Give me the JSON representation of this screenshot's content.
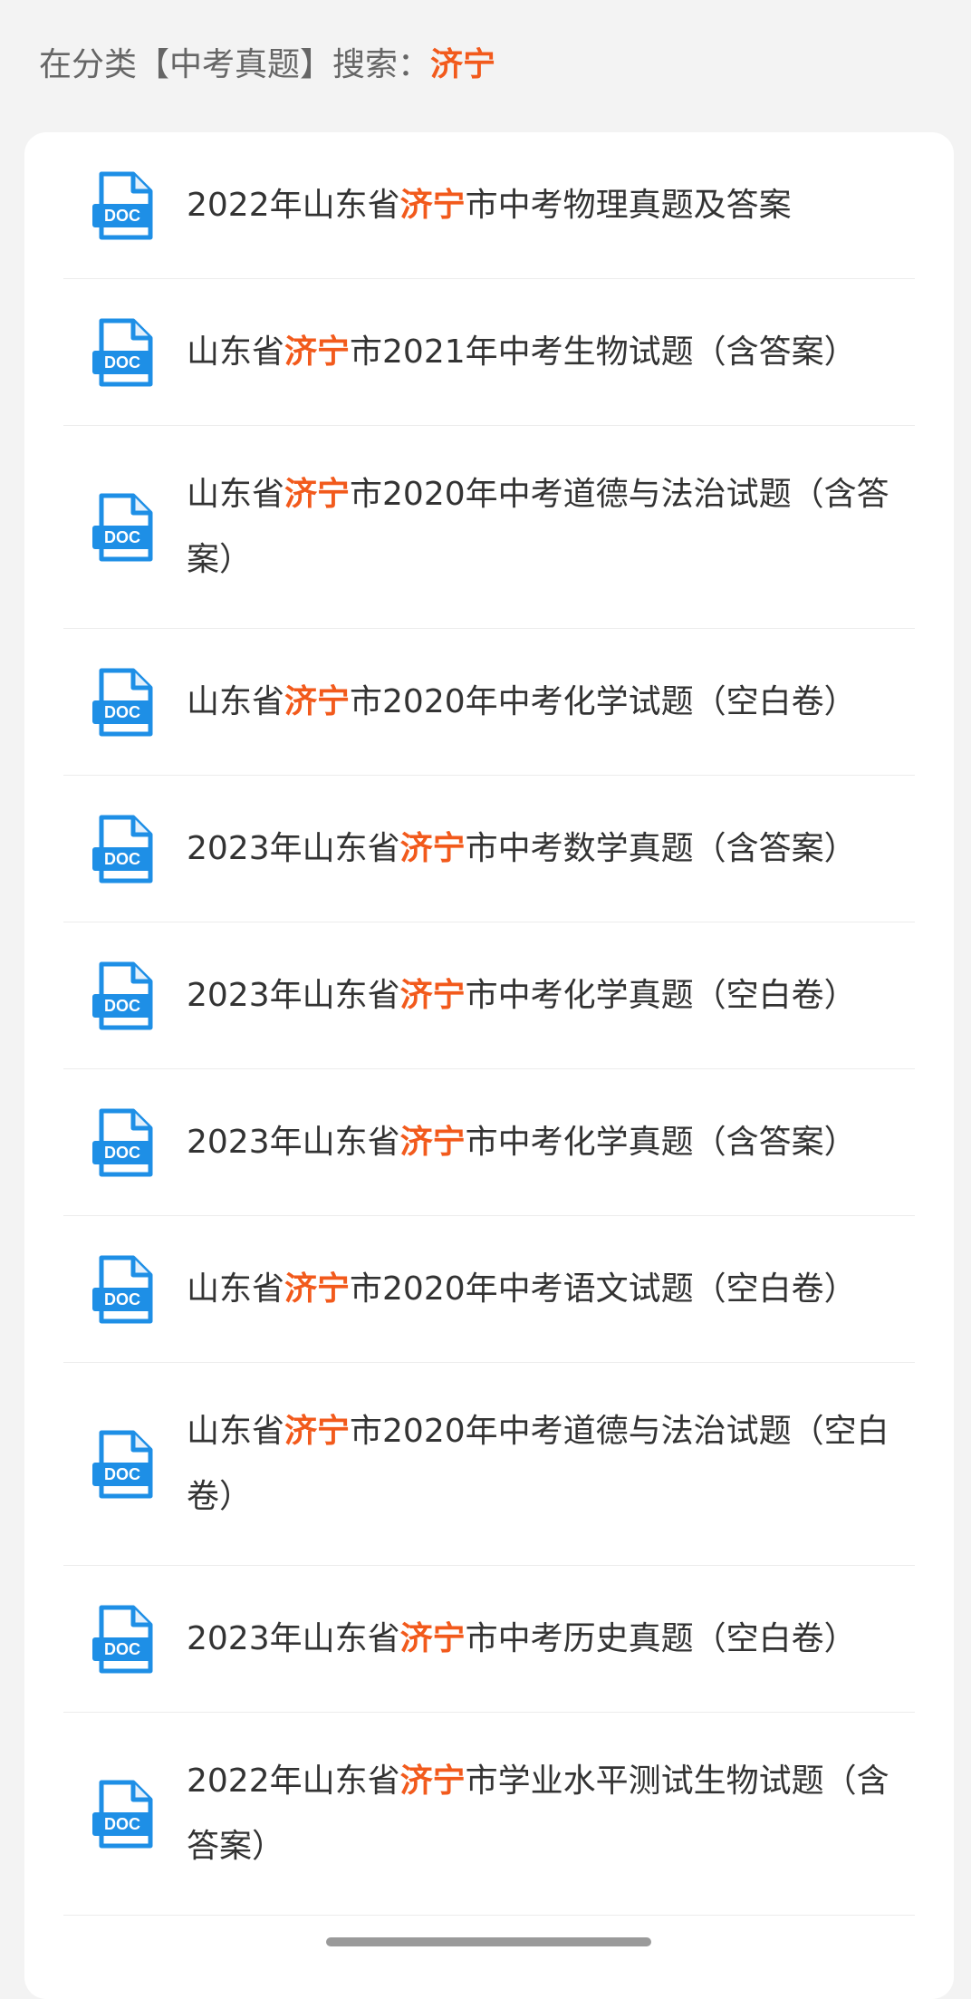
{
  "search": {
    "prefix": "在分类【中考真题】搜索：",
    "keyword": "济宁"
  },
  "results": [
    {
      "before": "2022年山东省",
      "keyword": "济宁",
      "after": "市中考物理真题及答案",
      "icon": "doc-file-icon",
      "icon_label": "DOC"
    },
    {
      "before": "山东省",
      "keyword": "济宁",
      "after": "市2021年中考生物试题（含答案）",
      "icon": "doc-file-icon",
      "icon_label": "DOC"
    },
    {
      "before": "山东省",
      "keyword": "济宁",
      "after": "市2020年中考道德与法治试题（含答案）",
      "icon": "doc-file-icon",
      "icon_label": "DOC"
    },
    {
      "before": "山东省",
      "keyword": "济宁",
      "after": "市2020年中考化学试题（空白卷）",
      "icon": "doc-file-icon",
      "icon_label": "DOC"
    },
    {
      "before": "2023年山东省",
      "keyword": "济宁",
      "after": "市中考数学真题（含答案）",
      "icon": "doc-file-icon",
      "icon_label": "DOC"
    },
    {
      "before": "2023年山东省",
      "keyword": "济宁",
      "after": "市中考化学真题（空白卷）",
      "icon": "doc-file-icon",
      "icon_label": "DOC"
    },
    {
      "before": "2023年山东省",
      "keyword": "济宁",
      "after": "市中考化学真题（含答案）",
      "icon": "doc-file-icon",
      "icon_label": "DOC"
    },
    {
      "before": "山东省",
      "keyword": "济宁",
      "after": "市2020年中考语文试题（空白卷）",
      "icon": "doc-file-icon",
      "icon_label": "DOC"
    },
    {
      "before": "山东省",
      "keyword": "济宁",
      "after": "市2020年中考道德与法治试题（空白卷）",
      "icon": "doc-file-icon",
      "icon_label": "DOC"
    },
    {
      "before": "2023年山东省",
      "keyword": "济宁",
      "after": "市中考历史真题（空白卷）",
      "icon": "doc-file-icon",
      "icon_label": "DOC"
    },
    {
      "before": "2022年山东省",
      "keyword": "济宁",
      "after": "市学业水平测试生物试题（含答案）",
      "icon": "doc-file-icon",
      "icon_label": "DOC"
    }
  ],
  "colors": {
    "keyword_highlight": "#f25a1c",
    "doc_icon": "#1e8fe6"
  }
}
